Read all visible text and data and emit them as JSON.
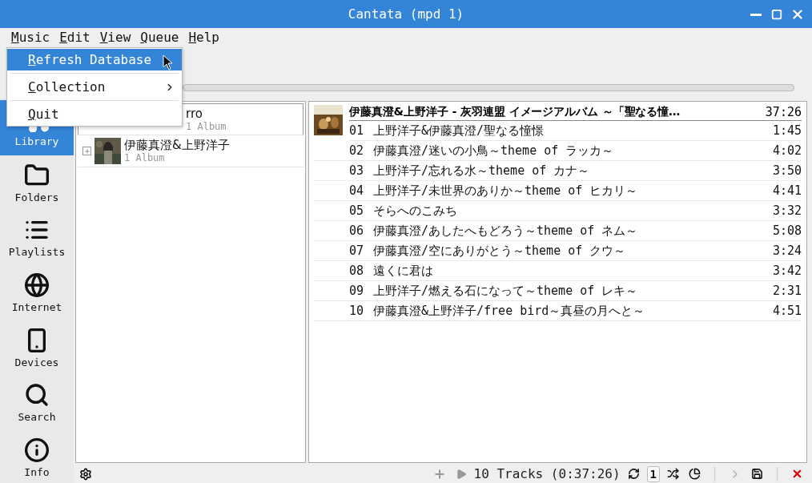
{
  "window": {
    "title": "Cantata (mpd 1)"
  },
  "menubar": [
    {
      "label": "Music"
    },
    {
      "label": "Edit"
    },
    {
      "label": "View"
    },
    {
      "label": "Queue"
    },
    {
      "label": "Help"
    }
  ],
  "menu": [
    {
      "kind": "item",
      "label": "Refresh Database",
      "selected": true,
      "submenu": false
    },
    {
      "kind": "separator"
    },
    {
      "kind": "item",
      "label": "Collection",
      "selected": false,
      "submenu": true
    },
    {
      "kind": "separator"
    },
    {
      "kind": "item",
      "label": "Quit",
      "selected": false,
      "submenu": false
    }
  ],
  "progress": {
    "level": 0
  },
  "sidebar": {
    "items": [
      {
        "label": "Library",
        "selected": true
      },
      {
        "label": "Folders",
        "selected": false
      },
      {
        "label": "Playlists",
        "selected": false
      },
      {
        "label": "Internet",
        "selected": false
      },
      {
        "label": "Devices",
        "selected": false
      },
      {
        "label": "Search",
        "selected": false
      },
      {
        "label": "Info",
        "selected": false
      }
    ]
  },
  "library": {
    "artists": [
      {
        "name": "rro",
        "albums": "1 Album",
        "covered": true
      },
      {
        "name": "伊藤真澄&上野洋子",
        "albums": "1 Album",
        "covered": false
      }
    ]
  },
  "playqueue": {
    "album_header": "伊藤真澄&上野洋子 - 灰羽連盟 イメージアルバム ～「聖なる憧…",
    "album_duration": "37:26",
    "tracks": [
      {
        "number": "01",
        "title": "上野洋子&伊藤真澄/聖なる憧憬",
        "duration": "1:45"
      },
      {
        "number": "02",
        "title": "伊藤真澄/迷いの小鳥～theme of ラッカ～",
        "duration": "4:02"
      },
      {
        "number": "03",
        "title": "上野洋子/忘れる水～theme of カナ～",
        "duration": "3:50"
      },
      {
        "number": "04",
        "title": "上野洋子/未世界のありか～theme of ヒカリ～",
        "duration": "4:41"
      },
      {
        "number": "05",
        "title": "そらへのこみち",
        "duration": "3:32"
      },
      {
        "number": "06",
        "title": "伊藤真澄/あしたへもどろう～theme of ネム～",
        "duration": "5:08"
      },
      {
        "number": "07",
        "title": "伊藤真澄/空にありがとう～theme of クウ～",
        "duration": "3:24"
      },
      {
        "number": "08",
        "title": "遠くに君は",
        "duration": "3:42"
      },
      {
        "number": "09",
        "title": "上野洋子/燃える石になって～theme of レキ～",
        "duration": "2:31"
      },
      {
        "number": "10",
        "title": "伊藤真澄&上野洋子/free bird～真昼の月へと～",
        "duration": "4:51"
      }
    ]
  },
  "status_bar": {
    "summary": "10 Tracks (0:37:26)",
    "single": {
      "label": "1",
      "selected": true
    }
  }
}
